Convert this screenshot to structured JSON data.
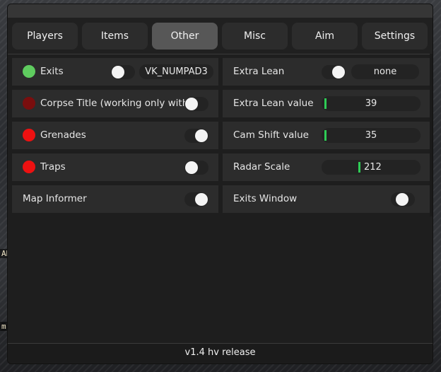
{
  "tabs": [
    "Players",
    "Items",
    "Other",
    "Misc",
    "Aim",
    "Settings"
  ],
  "active_tab": "Other",
  "left": {
    "exits": {
      "label": "Exits",
      "key": "VK_NUMPAD3",
      "dot_color": "#5fcc5f"
    },
    "corpse_title": {
      "label": "Corpse Title (working only with item",
      "dot_color": "#7a0e0e"
    },
    "grenades": {
      "label": "Grenades",
      "dot_color": "#ee1111"
    },
    "traps": {
      "label": "Traps",
      "dot_color": "#ee1111"
    },
    "map_informer": {
      "label": "Map Informer"
    }
  },
  "right": {
    "extra_lean": {
      "label": "Extra Lean",
      "key": "none"
    },
    "extra_lean_value": {
      "label": "Extra Lean value",
      "value": "39"
    },
    "cam_shift_value": {
      "label": "Cam Shift value",
      "value": "35"
    },
    "radar_scale": {
      "label": "Radar Scale",
      "value": "212"
    },
    "exits_window": {
      "label": "Exits Window"
    }
  },
  "footer": {
    "version": "v1.4 hv release"
  },
  "background": {
    "text_ar": "AR",
    "text_m": "m]"
  },
  "colors": {
    "accent_green": "#2ecc55",
    "panel": "#2c2c2c",
    "window": "#1e1e1e"
  }
}
